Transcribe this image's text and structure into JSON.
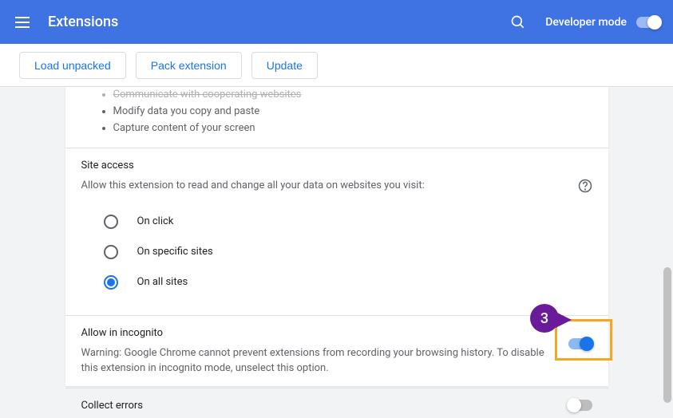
{
  "header": {
    "title": "Extensions",
    "dev_mode_label": "Developer mode"
  },
  "toolbar": {
    "load_unpacked": "Load unpacked",
    "pack_extension": "Pack extension",
    "update": "Update"
  },
  "permissions": {
    "items": [
      "Communicate with cooperating websites",
      "Modify data you copy and paste",
      "Capture content of your screen"
    ]
  },
  "site_access": {
    "title": "Site access",
    "desc": "Allow this extension to read and change all your data on websites you visit:",
    "options": {
      "on_click": "On click",
      "on_specific": "On specific sites",
      "on_all": "On all sites"
    }
  },
  "incognito": {
    "title": "Allow in incognito",
    "warning": "Warning: Google Chrome cannot prevent extensions from recording your browsing history. To disable this extension in incognito mode, unselect this option."
  },
  "collect_errors": {
    "title": "Collect errors"
  },
  "callout": {
    "number": "3"
  }
}
